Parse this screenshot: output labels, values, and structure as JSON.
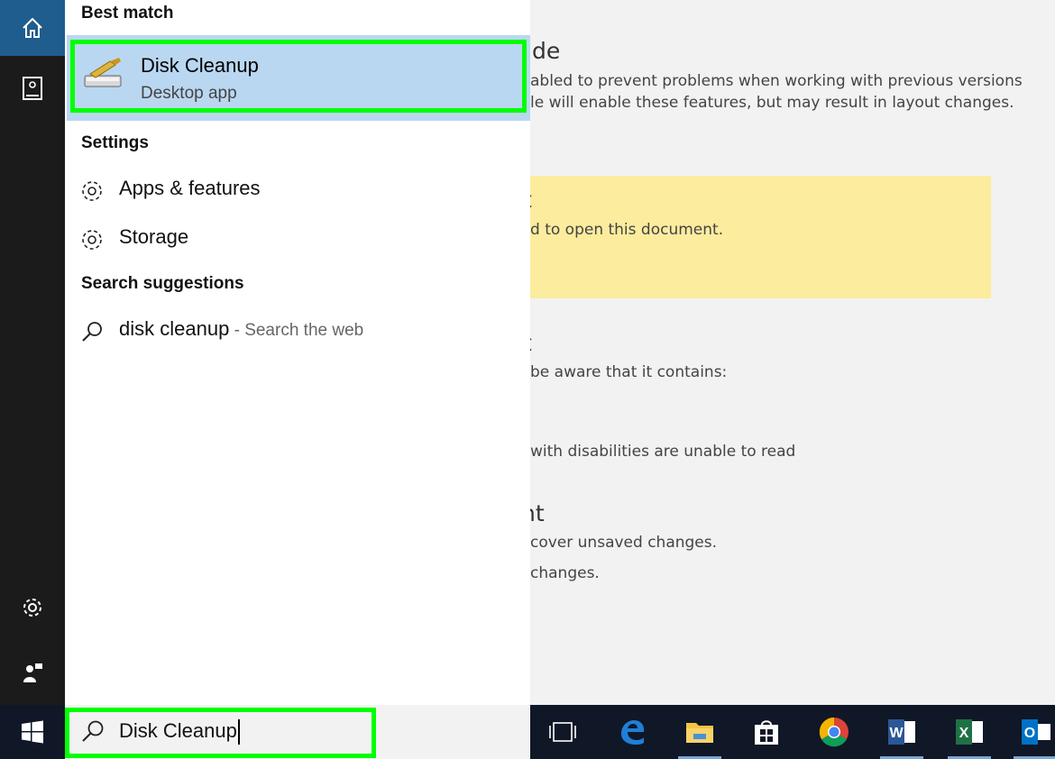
{
  "background_document": {
    "heading_1": "de",
    "line_1a": "abled to prevent problems when working with previous versions",
    "line_1b": "le will enable these features, but may result in layout changes.",
    "heading_2": "t",
    "line_2": "d to open this document.",
    "heading_3": "t",
    "line_3": "be aware that it contains:",
    "line_4": "with disabilities are unable to read",
    "heading_4": "nt",
    "line_5": "cover unsaved changes.",
    "line_6": "changes."
  },
  "results": {
    "best_match_header": "Best match",
    "best_match": {
      "title": "Disk Cleanup",
      "subtitle": "Desktop app"
    },
    "settings_header": "Settings",
    "settings": [
      {
        "label": "Apps & features"
      },
      {
        "label": "Storage"
      }
    ],
    "suggestions_header": "Search suggestions",
    "suggestion": {
      "query": "disk cleanup",
      "hint": " - Search the web"
    }
  },
  "search": {
    "value": "Disk Cleanup"
  },
  "colors": {
    "highlight": "#bad7f1",
    "outline": "#00ff00",
    "rail": "#1b1b1b",
    "home_tile": "#1f5d8f",
    "taskbar": "#101727",
    "info_banner": "#fcec9e"
  },
  "icons": {
    "rail": [
      "home-icon",
      "documents-icon",
      "settings-icon",
      "feedback-icon"
    ],
    "taskbar": [
      "windows-start-icon",
      "task-view-icon",
      "edge-icon",
      "file-explorer-icon",
      "store-icon",
      "chrome-icon",
      "word-icon",
      "excel-icon",
      "outlook-icon"
    ]
  }
}
